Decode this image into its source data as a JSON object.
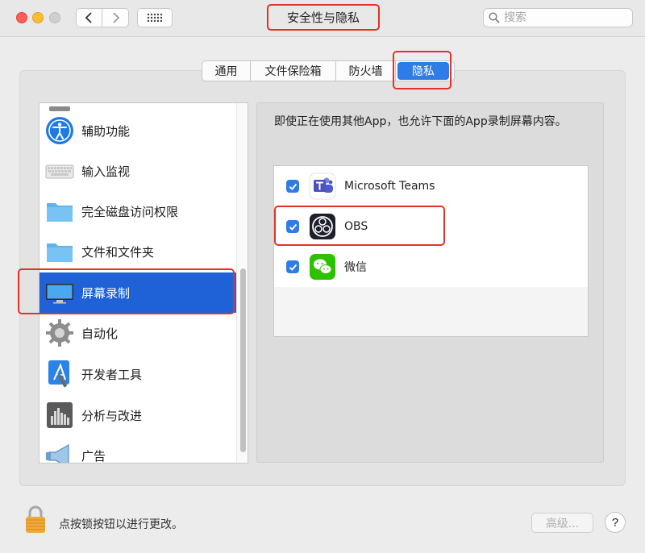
{
  "window": {
    "title": "安全性与隐私",
    "search_placeholder": "搜索"
  },
  "toolbar": {
    "icons": [
      "chevron-left-icon",
      "chevron-right-icon",
      "grid-icon",
      "search-icon"
    ]
  },
  "tabs": [
    {
      "label": "通用",
      "active": false
    },
    {
      "label": "文件保险箱",
      "active": false
    },
    {
      "label": "防火墙",
      "active": false
    },
    {
      "label": "隐私",
      "active": true
    }
  ],
  "sidebar": {
    "items": [
      {
        "label": "辅助功能",
        "icon": "accessibility-icon",
        "selected": false
      },
      {
        "label": "输入监视",
        "icon": "keyboard-icon",
        "selected": false
      },
      {
        "label": "完全磁盘访问权限",
        "icon": "folder-icon",
        "selected": false
      },
      {
        "label": "文件和文件夹",
        "icon": "folder-icon",
        "selected": false
      },
      {
        "label": "屏幕录制",
        "icon": "display-icon",
        "selected": true
      },
      {
        "label": "自动化",
        "icon": "gear-icon",
        "selected": false
      },
      {
        "label": "开发者工具",
        "icon": "developer-tools-icon",
        "selected": false
      },
      {
        "label": "分析与改进",
        "icon": "analytics-icon",
        "selected": false
      },
      {
        "label": "广告",
        "icon": "megaphone-icon",
        "selected": false
      }
    ]
  },
  "content": {
    "description": "即使正在使用其他App，也允许下面的App录制屏幕内容。",
    "apps": [
      {
        "name": "Microsoft Teams",
        "checked": true,
        "icon": "teams-icon"
      },
      {
        "name": "OBS",
        "checked": true,
        "icon": "obs-icon"
      },
      {
        "name": "微信",
        "checked": true,
        "icon": "wechat-icon"
      }
    ]
  },
  "footer": {
    "lock_text": "点按锁按钮以进行更改。",
    "advanced_label": "高级...",
    "help_label": "?"
  },
  "colors": {
    "accent": "#2f7ce6",
    "selection": "#1f62d8",
    "annotation": "#e2332a"
  }
}
